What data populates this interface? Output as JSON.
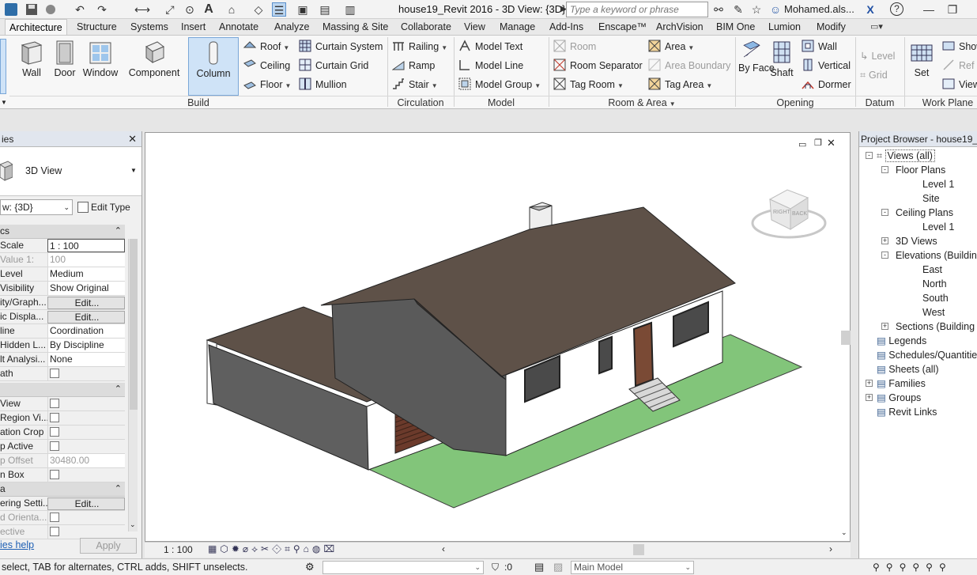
{
  "titlebar": {
    "title": "house19_Revit 2016 - 3D View: {3D}",
    "search_placeholder": "Type a keyword or phrase",
    "user": "Mohamed.als..."
  },
  "tabs": [
    "Architecture",
    "Structure",
    "Systems",
    "Insert",
    "Annotate",
    "Analyze",
    "Massing & Site",
    "Collaborate",
    "View",
    "Manage",
    "Add-Ins",
    "Enscape™",
    "ArchVision",
    "BIM One",
    "Lumion",
    "Modify"
  ],
  "ribbon": {
    "build": {
      "label": "Build",
      "big": [
        "Wall",
        "Door",
        "Window",
        "Component",
        "Column"
      ],
      "small": [
        "Roof",
        "Ceiling",
        "Floor",
        "Curtain System",
        "Curtain Grid",
        "Mullion"
      ]
    },
    "circulation": {
      "label": "Circulation",
      "items": [
        "Railing",
        "Ramp",
        "Stair"
      ]
    },
    "model": {
      "label": "Model",
      "items": [
        "Model Text",
        "Model Line",
        "Model Group"
      ]
    },
    "room_area": {
      "label": "Room & Area",
      "items": [
        "Room",
        "Room Separator",
        "Tag Room",
        "Area",
        "Area Boundary",
        "Tag Area"
      ]
    },
    "opening": {
      "label": "Opening",
      "big": [
        "By Face",
        "Shaft"
      ],
      "small": [
        "Wall",
        "Vertical",
        "Dormer"
      ]
    },
    "datum": {
      "label": "Datum",
      "items": [
        "Level",
        "Grid"
      ]
    },
    "workplane": {
      "label": "Work Plane",
      "big": "Set",
      "small": [
        "Show",
        "Ref",
        "View"
      ]
    }
  },
  "properties": {
    "header": "ies",
    "type_name": "3D View",
    "view_selector": "w: {3D}",
    "edit_type": "Edit Type",
    "group1": "cs",
    "rows1": [
      {
        "k": "Scale",
        "v": "1 : 100"
      },
      {
        "k": "Value  1:",
        "v": "100"
      },
      {
        "k": "Level",
        "v": "Medium"
      },
      {
        "k": "Visibility",
        "v": "Show Original"
      },
      {
        "k": "ity/Graph...",
        "v": "Edit..."
      },
      {
        "k": "ic Displa...",
        "v": "Edit..."
      },
      {
        "k": "line",
        "v": "Coordination"
      },
      {
        "k": "Hidden L...",
        "v": "By Discipline"
      },
      {
        "k": "lt Analysi...",
        "v": "None"
      },
      {
        "k": "ath",
        "v": ""
      }
    ],
    "rows2": [
      {
        "k": "View",
        "v": ""
      },
      {
        "k": "Region Vi...",
        "v": ""
      },
      {
        "k": "ation Crop",
        "v": ""
      },
      {
        "k": "p Active",
        "v": ""
      },
      {
        "k": "p Offset",
        "v": "30480.00"
      },
      {
        "k": "n Box",
        "v": ""
      }
    ],
    "group3": "a",
    "rows3": [
      {
        "k": "ering Setti...",
        "v": "Edit..."
      },
      {
        "k": "d Orienta...",
        "v": ""
      },
      {
        "k": "ective",
        "v": ""
      }
    ],
    "help_link": "ies help",
    "apply": "Apply"
  },
  "browser": {
    "header": "Project Browser - house19_Re",
    "nodes": [
      {
        "label": "Views (all)",
        "level": 0,
        "exp": "-"
      },
      {
        "label": "Floor Plans",
        "level": 1,
        "exp": "-"
      },
      {
        "label": "Level 1",
        "level": 2,
        "exp": ""
      },
      {
        "label": "Site",
        "level": 2,
        "exp": ""
      },
      {
        "label": "Ceiling Plans",
        "level": 1,
        "exp": "-"
      },
      {
        "label": "Level 1",
        "level": 2,
        "exp": ""
      },
      {
        "label": "3D Views",
        "level": 1,
        "exp": "+"
      },
      {
        "label": "Elevations (Building",
        "level": 1,
        "exp": "-"
      },
      {
        "label": "East",
        "level": 2,
        "exp": ""
      },
      {
        "label": "North",
        "level": 2,
        "exp": ""
      },
      {
        "label": "South",
        "level": 2,
        "exp": ""
      },
      {
        "label": "West",
        "level": 2,
        "exp": ""
      },
      {
        "label": "Sections (Building S",
        "level": 1,
        "exp": "+"
      },
      {
        "label": "Legends",
        "level": 0,
        "exp": ""
      },
      {
        "label": "Schedules/Quantitie",
        "level": 0,
        "exp": ""
      },
      {
        "label": "Sheets (all)",
        "level": 0,
        "exp": ""
      },
      {
        "label": "Families",
        "level": 0,
        "exp": "+"
      },
      {
        "label": "Groups",
        "level": 0,
        "exp": "+"
      },
      {
        "label": "Revit Links",
        "level": 0,
        "exp": ""
      }
    ]
  },
  "viewcube": {
    "right": "RIGHT",
    "back": "BACK"
  },
  "view_control": {
    "scale": "1 : 100"
  },
  "status": {
    "message": "select, TAB for alternates, CTRL adds, SHIFT unselects.",
    "filter_count": ":0",
    "workset": "Main Model"
  },
  "colors": {
    "accent": "#1e74c6",
    "roof": "#5e5148",
    "wall_dark": "#5f5f5f",
    "wall_light": "#ffffff",
    "grass": "#82c57a"
  }
}
